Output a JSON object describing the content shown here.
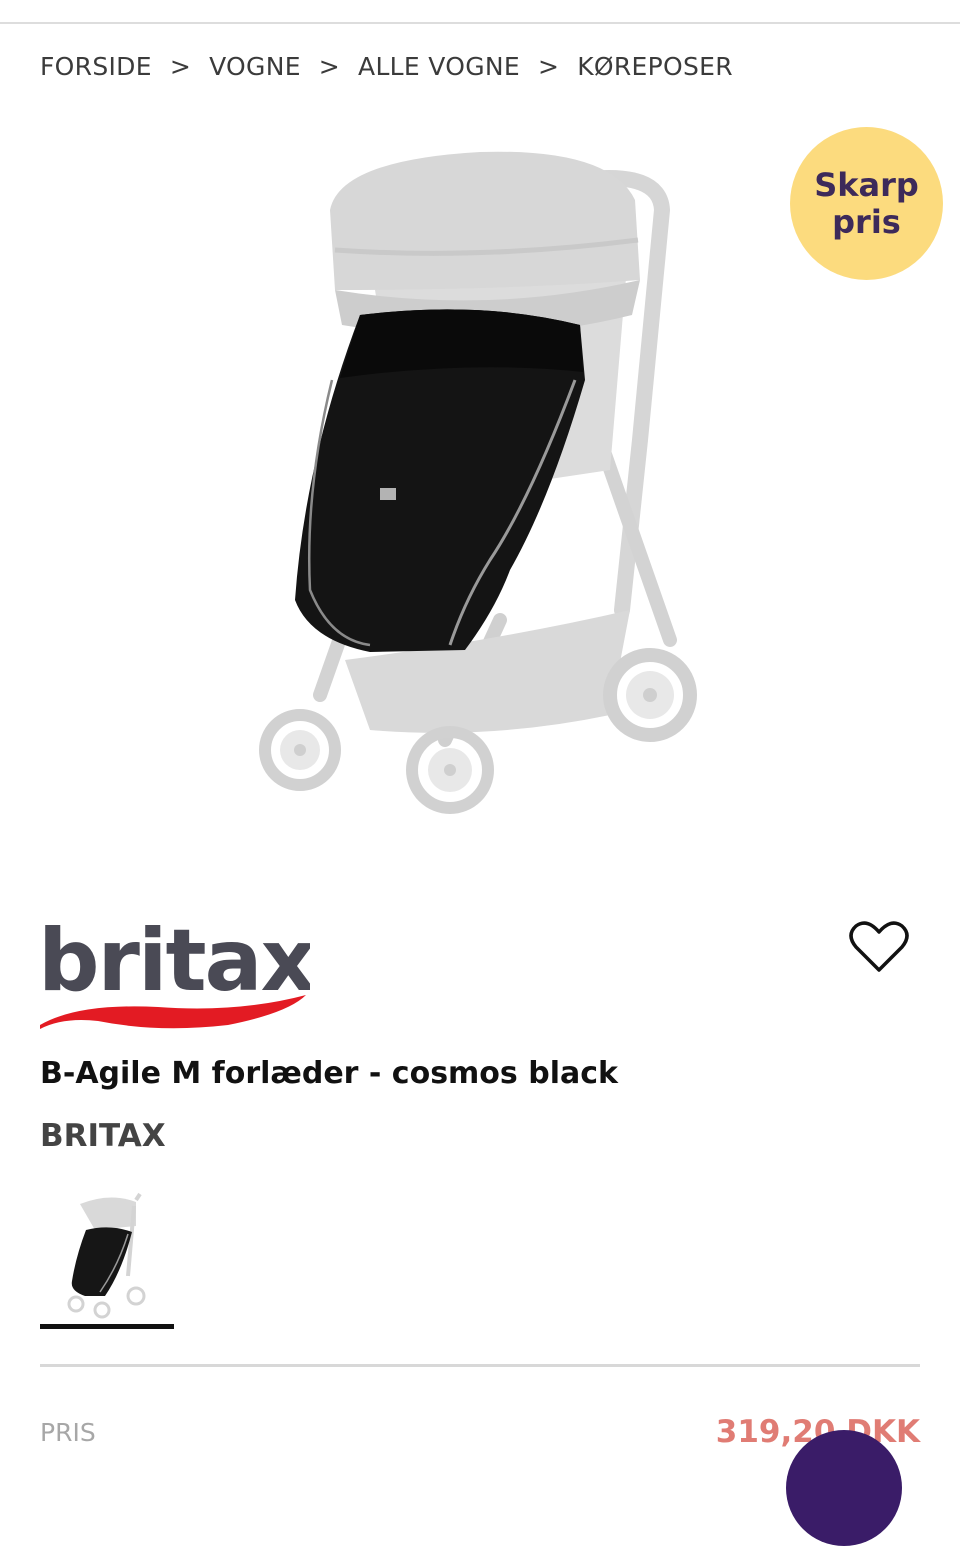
{
  "breadcrumb": {
    "items": [
      "FORSIDE",
      "VOGNE",
      "ALLE VOGNE",
      "KØREPOSER"
    ],
    "separator": ">"
  },
  "badge": {
    "line1": "Skarp",
    "line2": "pris",
    "color": "#fcdb7e",
    "text_color": "#3d2a5a"
  },
  "hero_image": {
    "icon": "stroller-with-footmuff-image"
  },
  "brand_logo": {
    "text": "britax",
    "text_color": "#4a4a55",
    "swoosh_color": "#e31b23"
  },
  "favorite": {
    "icon": "heart-outline-icon"
  },
  "product": {
    "title": "B-Agile M forlæder - cosmos black",
    "brand": "BRITAX"
  },
  "price": {
    "label": "PRIS",
    "value": "319,20 DKK",
    "color": "#e07c74"
  },
  "chat": {
    "icon": "chat-bubble-icon",
    "color": "#3a1c68"
  }
}
